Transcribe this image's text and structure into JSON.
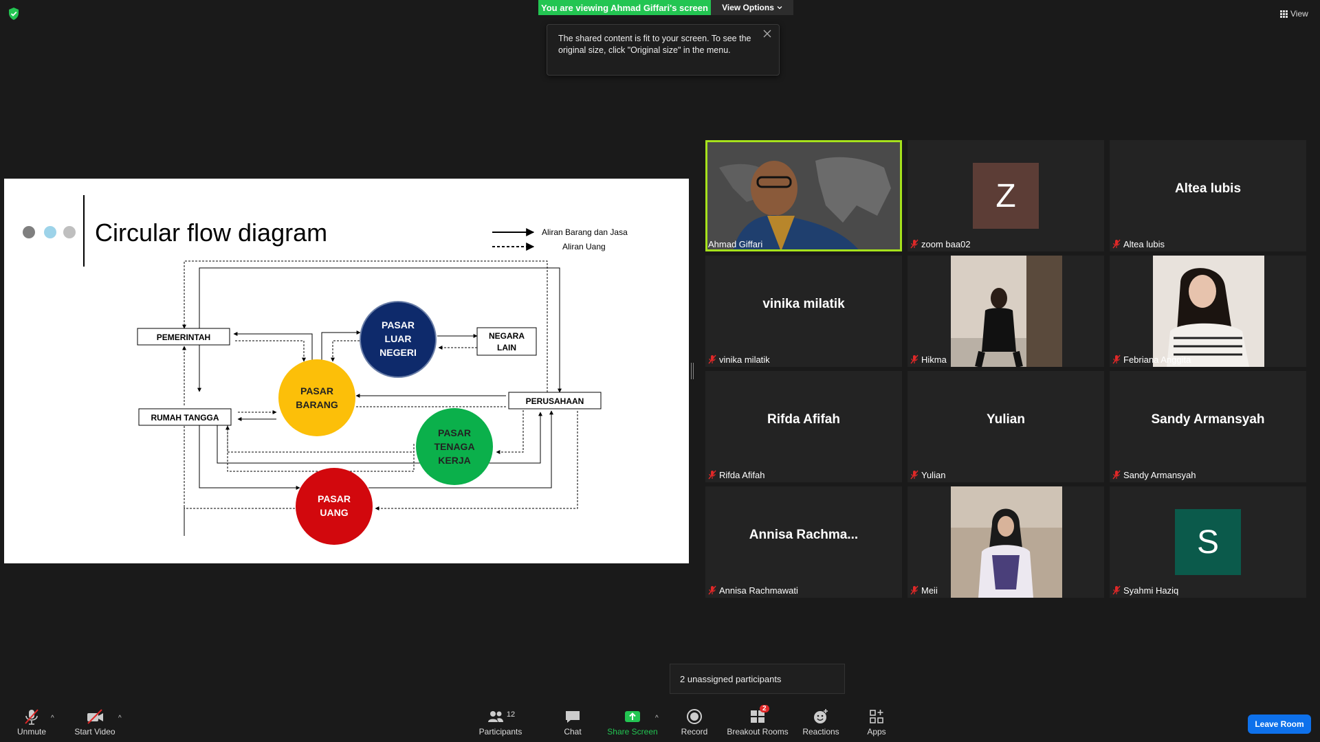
{
  "top_bar": {
    "banner_text": "You are viewing Ahmad Giffari's screen",
    "view_options_label": "View Options",
    "view_label": "View"
  },
  "tooltip": {
    "line1": "The shared content is fit to your screen. To see the",
    "line2": "original size, click \"Original size\" in the menu."
  },
  "slide": {
    "title": "Circular flow diagram",
    "legend": {
      "solid_label": "Aliran Barang dan Jasa",
      "dashed_label": "Aliran Uang"
    },
    "boxes": {
      "pemerintah": "PEMERINTAH",
      "rumah_tangga": "RUMAH TANGGA",
      "perusahaan": "PERUSAHAAN",
      "negara_line1": "NEGARA",
      "negara_line2": "LAIN"
    },
    "circles": {
      "luar_l1": "PASAR",
      "luar_l2": "LUAR",
      "luar_l3": "NEGERI",
      "barang_l1": "PASAR",
      "barang_l2": "BARANG",
      "tenaga_l1": "PASAR",
      "tenaga_l2": "TENAGA",
      "tenaga_l3": "KERJA",
      "uang_l1": "PASAR",
      "uang_l2": "UANG"
    },
    "colors": {
      "luar": "#0e2a6b",
      "barang": "#fcbf09",
      "tenaga": "#0bb04b",
      "uang": "#d2080d"
    }
  },
  "participants": [
    {
      "label": "Ahmad Giffari",
      "big": "",
      "avatar": "",
      "video": true
    },
    {
      "label": "zoom baa02",
      "big": "",
      "avatar": "Z",
      "avatar_color": "#5c3d36"
    },
    {
      "label": "Altea lubis",
      "big": "Altea lubis"
    },
    {
      "label": "vinika milatik",
      "big": "vinika milatik"
    },
    {
      "label": "Hikma",
      "big": "",
      "video": true
    },
    {
      "label": "Febriana Anggita",
      "big": "",
      "video": true
    },
    {
      "label": "Rifda Afifah",
      "big": "Rifda Afifah"
    },
    {
      "label": "Yulian",
      "big": "Yulian"
    },
    {
      "label": "Sandy Armansyah",
      "big": "Sandy Armansyah"
    },
    {
      "label": "Annisa Rachmawati",
      "big": "Annisa  Rachma..."
    },
    {
      "label": "Meii",
      "big": "",
      "video": true
    },
    {
      "label": "Syahmi Haziq",
      "big": "",
      "avatar": "S",
      "avatar_color": "#0b5a4b"
    }
  ],
  "toast": {
    "text": "2 unassigned participants"
  },
  "toolbar": {
    "unmute": "Unmute",
    "start_video": "Start Video",
    "participants": "Participants",
    "participants_count": "12",
    "chat": "Chat",
    "share_screen": "Share Screen",
    "record": "Record",
    "breakout_rooms": "Breakout Rooms",
    "breakout_badge": "2",
    "reactions": "Reactions",
    "apps": "Apps",
    "leave_room": "Leave Room"
  }
}
